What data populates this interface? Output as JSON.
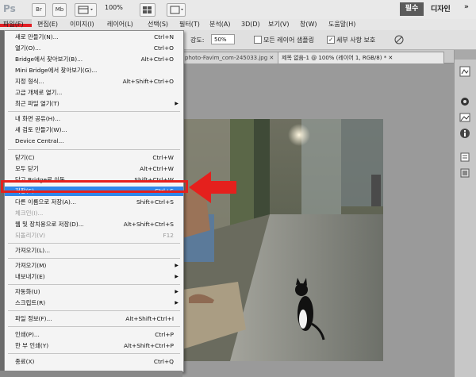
{
  "app": {
    "logo": "Ps",
    "buttons": [
      "Br",
      "Mb"
    ],
    "zoom": "100%",
    "workspaces": {
      "active": "필수",
      "other": "디자인",
      "more": "»"
    }
  },
  "menubar": [
    "파일(F)",
    "편집(E)",
    "이미지(I)",
    "레이어(L)",
    "선택(S)",
    "필터(T)",
    "분석(A)",
    "3D(D)",
    "보기(V)",
    "창(W)",
    "도움말(H)"
  ],
  "options": {
    "strength_label": "강도:",
    "strength_value": "50%",
    "sample_all_layers": "모든 레이어 샘플링",
    "detail_preserve": "세부 사항 보호"
  },
  "tabs": [
    {
      "label": "photo-Favim_com-245033.jpg ✕"
    },
    {
      "label": "제목 없음-1 @ 100% (레이어 1, RGB/8) * ✕"
    }
  ],
  "file_menu": {
    "items": [
      {
        "label": "새로 만들기(N)...",
        "shortcut": "Ctrl+N"
      },
      {
        "label": "열기(O)...",
        "shortcut": "Ctrl+O"
      },
      {
        "label": "Bridge에서 찾아보기(B)...",
        "shortcut": "Alt+Ctrl+O"
      },
      {
        "label": "Mini Bridge에서 찾아보기(G)...",
        "shortcut": ""
      },
      {
        "label": "지정 형식...",
        "shortcut": "Alt+Shift+Ctrl+O"
      },
      {
        "label": "고급 개체로 열기...",
        "shortcut": ""
      },
      {
        "label": "최근 파일 열기(T)",
        "shortcut": ""
      },
      {
        "label": "내 화면 공유(H)...",
        "shortcut": ""
      },
      {
        "label": "새 검토 만들기(W)...",
        "shortcut": ""
      },
      {
        "label": "Device Central...",
        "shortcut": ""
      },
      {
        "label": "닫기(C)",
        "shortcut": "Ctrl+W"
      },
      {
        "label": "모두 닫기",
        "shortcut": "Alt+Ctrl+W"
      },
      {
        "label": "닫고 Bridge로 이동...",
        "shortcut": "Shift+Ctrl+W"
      },
      {
        "label": "저장(S)",
        "shortcut": "Ctrl+S"
      },
      {
        "label": "다른 이름으로 저장(A)...",
        "shortcut": "Shift+Ctrl+S"
      },
      {
        "label": "체크인(I)...",
        "shortcut": ""
      },
      {
        "label": "웹 및 장치용으로 저장(D)...",
        "shortcut": "Alt+Shift+Ctrl+S"
      },
      {
        "label": "되돌리기(V)",
        "shortcut": "F12"
      },
      {
        "label": "가져오기(L)...",
        "shortcut": ""
      },
      {
        "label": "가져오기(M)",
        "shortcut": ""
      },
      {
        "label": "내보내기(E)",
        "shortcut": ""
      },
      {
        "label": "자동화(U)",
        "shortcut": ""
      },
      {
        "label": "스크립트(R)",
        "shortcut": ""
      },
      {
        "label": "파일 정보(F)...",
        "shortcut": "Alt+Shift+Ctrl+I"
      },
      {
        "label": "인쇄(P)...",
        "shortcut": "Ctrl+P"
      },
      {
        "label": "한 부 인쇄(Y)",
        "shortcut": "Alt+Shift+Ctrl+P"
      },
      {
        "label": "종료(X)",
        "shortcut": "Ctrl+Q"
      }
    ],
    "submenu_arrow": "▶"
  }
}
